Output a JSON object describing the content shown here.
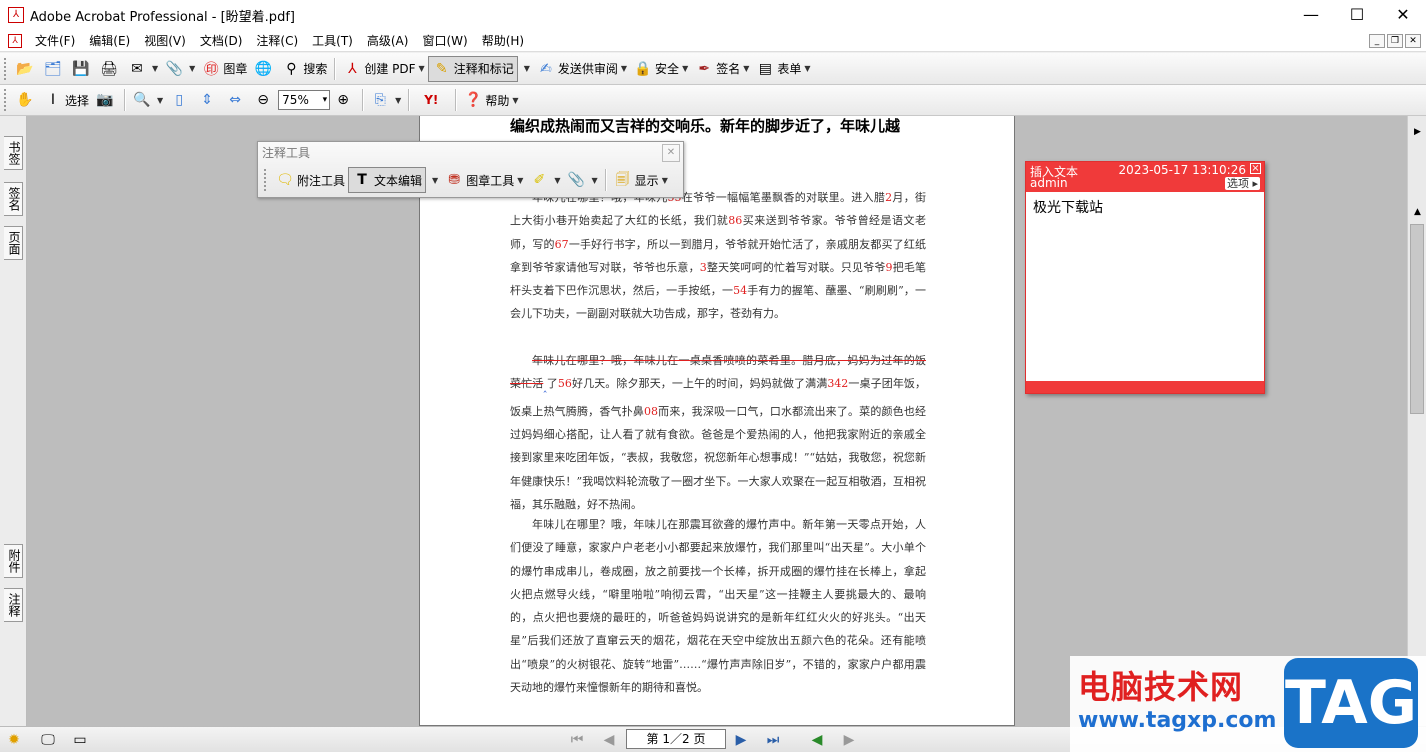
{
  "window": {
    "title": "Adobe Acrobat Professional - [盼望着.pdf]"
  },
  "menu": [
    "文件(F)",
    "编辑(E)",
    "视图(V)",
    "文档(D)",
    "注释(C)",
    "工具(T)",
    "高级(A)",
    "窗口(W)",
    "帮助(H)"
  ],
  "toolbar1": {
    "stamp": "图章",
    "search": "搜索",
    "create_pdf": "创建 PDF",
    "comment_markup": "注释和标记",
    "send_review": "发送供审阅",
    "security": "安全",
    "sign": "签名",
    "forms": "表单"
  },
  "toolbar2": {
    "select": "选择",
    "zoom": "75%",
    "help": "帮助"
  },
  "left_tabs": {
    "bookmarks": "书签",
    "signatures": "签名",
    "pages": "页面",
    "attachments": "附件",
    "comments": "注释"
  },
  "annot_toolbar": {
    "title": "注释工具",
    "note_tool": "附注工具",
    "text_edit": "文本编辑",
    "stamp_tool": "图章工具",
    "show": "显示"
  },
  "document": {
    "heading": "编织成热闹而又吉祥的交响乐。新年的脚步近了，年味儿越",
    "p1": {
      "a": "年味儿在哪里？哦，年味儿",
      "n1": "55",
      "b": "在爷爷一幅幅笔墨飘香的对联里。进入腊",
      "n2": "2",
      "c": "月，街上大街小巷开始卖起了大红的长纸，我们就",
      "n3": "86",
      "d": "买来送到爷爷家。爷爷曾经是语文老师，写的",
      "n4": "67",
      "e": "一手好行书字，所以一到腊月，爷爷就开始忙活了，亲戚朋友都买了红纸拿到爷爷家请他写对联，爷爷也乐意，",
      "n5": "3",
      "f": "整天笑呵呵的忙着写对联。只见爷爷",
      "n6": "9",
      "g": "把毛笔杆头支着下巴作沉思状，然后，一手按纸，一",
      "n7": "54",
      "h": "手有力的握笔、蘸墨、“刷刷刷”，一会儿下功夫，一副副对联就大功告成，那字，苍劲有力。"
    },
    "p2": {
      "strike": "年味儿在哪里？哦，年味儿在一桌桌香喷喷的菜肴里。腊月底，妈妈为过年的饭菜忙活",
      "a": "了",
      "n1": "56",
      "b": "好几天。除夕那天，一上午的时间，妈妈就做了满满",
      "n2": "342",
      "c": "一桌子团年饭，饭桌上热气腾腾，香气扑鼻",
      "n3": "08",
      "d": "而来，我深吸一口气，口水都流出来了。菜的颜色也经过妈妈细心搭配，让人看了就有食欲。爸爸是个爱热闹的人，他把我家附近的亲戚全接到家里来吃团年饭，“表叔，我敬您，祝您新年心想事成！”“姑姑，我敬您，祝您新年健康快乐！”我喝饮料轮流敬了一圈才坐下。一大家人欢聚在一起互相敬酒，互相祝福，其乐融融，好不热闹。"
    },
    "p3": "年味儿在哪里？哦，年味儿在那震耳欲聋的爆竹声中。新年第一天零点开始，人们便没了睡意，家家户户老老小小都要起来放爆竹，我们那里叫“出天星”。大小单个的爆竹串成串儿，卷成圈，放之前要找一个长棒，拆开成圈的爆竹挂在长棒上，拿起火把点燃导火线，“噼里啪啦”响彻云霄，“出天星”这一挂鞭主人要挑最大的、最响的，点火把也要烧的最旺的，听爸爸妈妈说讲究的是新年红红火火的好兆头。“出天星”后我们还放了直窜云天的烟花，烟花在天空中绽放出五颜六色的花朵。还有能喷出“喷泉”的火树银花、旋转“地雷”……“爆竹声声除旧岁”，不错的，家家户户都用震天动地的爆竹来憧憬新年的期待和喜悦。"
  },
  "note": {
    "type": "插入文本",
    "author": "admin",
    "datetime": "2023-05-17 13:10:26",
    "options": "选项",
    "content": "极光下载站"
  },
  "status": {
    "page_indicator": "第 1／2 页"
  },
  "watermark": {
    "title": "电脑技术网",
    "url": "www.tagxp.com",
    "tag": "TAG"
  },
  "colors": {
    "note_red": "#f03a3a",
    "number_red": "#e02020",
    "canvas_gray": "#bdbdbd"
  }
}
